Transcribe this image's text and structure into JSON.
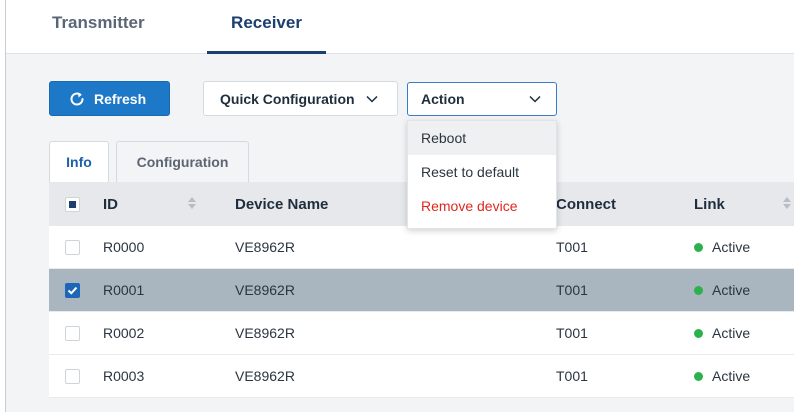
{
  "top_tabs": [
    {
      "label": "Transmitter",
      "active": false
    },
    {
      "label": "Receiver",
      "active": true
    }
  ],
  "toolbar": {
    "refresh_label": "Refresh",
    "quick_config_label": "Quick Configuration",
    "action_label": "Action"
  },
  "action_menu": {
    "items": [
      {
        "label": "Reboot"
      },
      {
        "label": "Reset to default"
      },
      {
        "label": "Remove device"
      }
    ]
  },
  "sub_tabs": [
    {
      "label": "Info",
      "active": true
    },
    {
      "label": "Configuration",
      "active": false
    }
  ],
  "table": {
    "headers": {
      "id": "ID",
      "name": "Device Name",
      "connect": "Connect",
      "link": "Link"
    },
    "rows": [
      {
        "id": "R0000",
        "name": "VE8962R",
        "connect": "T001",
        "link": "Active",
        "selected": false
      },
      {
        "id": "R0001",
        "name": "VE8962R",
        "connect": "T001",
        "link": "Active",
        "selected": true
      },
      {
        "id": "R0002",
        "name": "VE8962R",
        "connect": "T001",
        "link": "Active",
        "selected": false
      },
      {
        "id": "R0003",
        "name": "VE8962R",
        "connect": "T001",
        "link": "Active",
        "selected": false
      }
    ]
  },
  "colors": {
    "primary": "#1e78c8",
    "active_tab": "#1b3f6e",
    "selected_row": "#a9b6bf",
    "danger": "#e0261f",
    "status_active": "#2bb24c"
  }
}
